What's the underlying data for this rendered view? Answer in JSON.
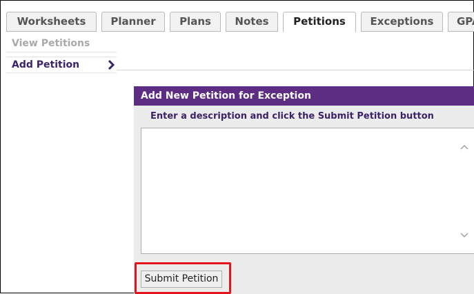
{
  "tabs": [
    {
      "label": "Worksheets",
      "active": false
    },
    {
      "label": "Planner",
      "active": false
    },
    {
      "label": "Plans",
      "active": false
    },
    {
      "label": "Notes",
      "active": false
    },
    {
      "label": "Petitions",
      "active": true
    },
    {
      "label": "Exceptions",
      "active": false
    },
    {
      "label": "GPA",
      "active": false
    }
  ],
  "subnav": {
    "view_petitions": "View Petitions",
    "add_petition": "Add Petition",
    "active_item": "Add Petition",
    "chevron_icon": "chevron-right-icon"
  },
  "panel": {
    "header": "Add New Petition for Exception",
    "instruction": "Enter a description and click the Submit Petition button",
    "description_value": ""
  },
  "submit_label": "Submit Petition",
  "colors": {
    "header_purple": "#5c2d82",
    "nav_active_text": "#3b2369",
    "nav_inactive_text": "#a9a9a9",
    "highlight_red": "#e3121b",
    "panel_background": "#ececec"
  }
}
